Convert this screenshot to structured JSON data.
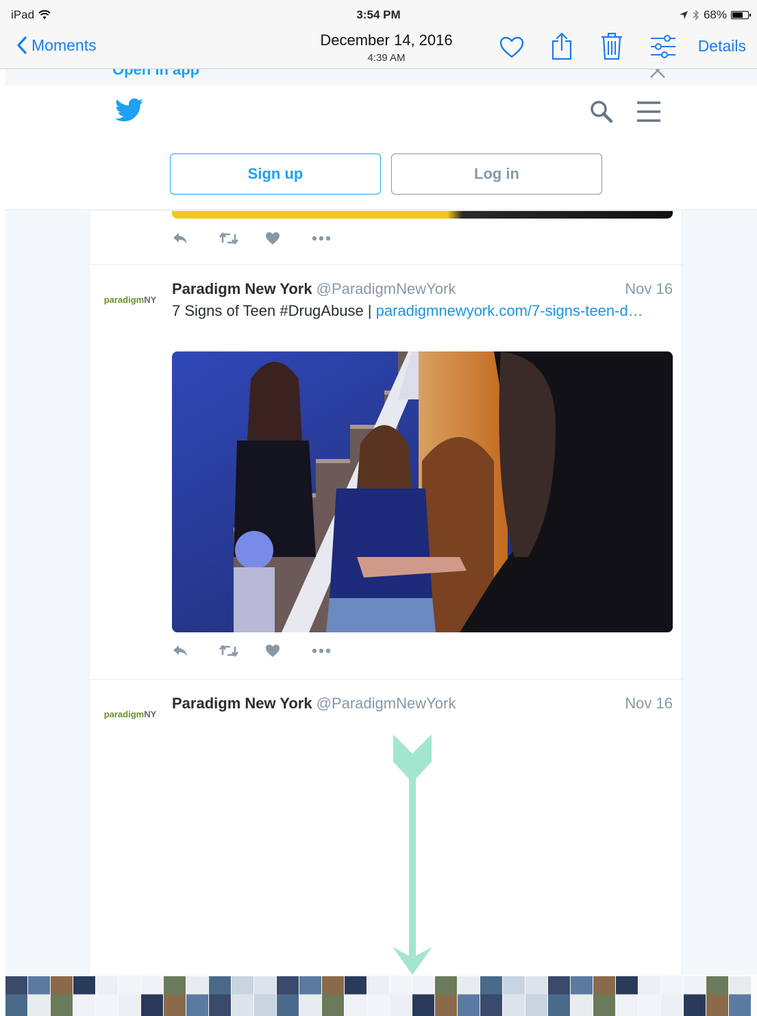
{
  "status_bar": {
    "device": "iPad",
    "time": "3:54 PM",
    "battery": "68%",
    "battery_level": 0.68
  },
  "nav_bar": {
    "back_label": "Moments",
    "date": "December 14, 2016",
    "time": "4:39 AM",
    "details_label": "Details",
    "accent_color": "#1a7cf0"
  },
  "web": {
    "open_in_app": "Open in app",
    "signup_label": "Sign up",
    "login_label": "Log in",
    "twitter_blue": "#1da1f2"
  },
  "tweets": [
    {
      "avatar_text_1": "paradigm",
      "avatar_text_2": "NY",
      "name": "Paradigm New York",
      "handle": "@ParadigmNewYork",
      "date": "Nov 16",
      "text": "7 Signs of Teen #DrugAbuse | ",
      "link": "paradigmnewyork.com/7-signs-teen-d…"
    },
    {
      "avatar_text_1": "paradigm",
      "avatar_text_2": "NY",
      "name": "Paradigm New York",
      "handle": "@ParadigmNewYork",
      "date": "Nov 16"
    }
  ],
  "icons": {
    "back": "chevron-left-icon",
    "favorite": "heart-icon",
    "share": "share-icon",
    "delete": "trash-icon",
    "adjust": "sliders-icon",
    "search": "search-icon",
    "menu": "hamburger-icon",
    "reply": "reply-icon",
    "retweet": "retweet-icon",
    "like": "like-icon",
    "more": "more-icon"
  }
}
